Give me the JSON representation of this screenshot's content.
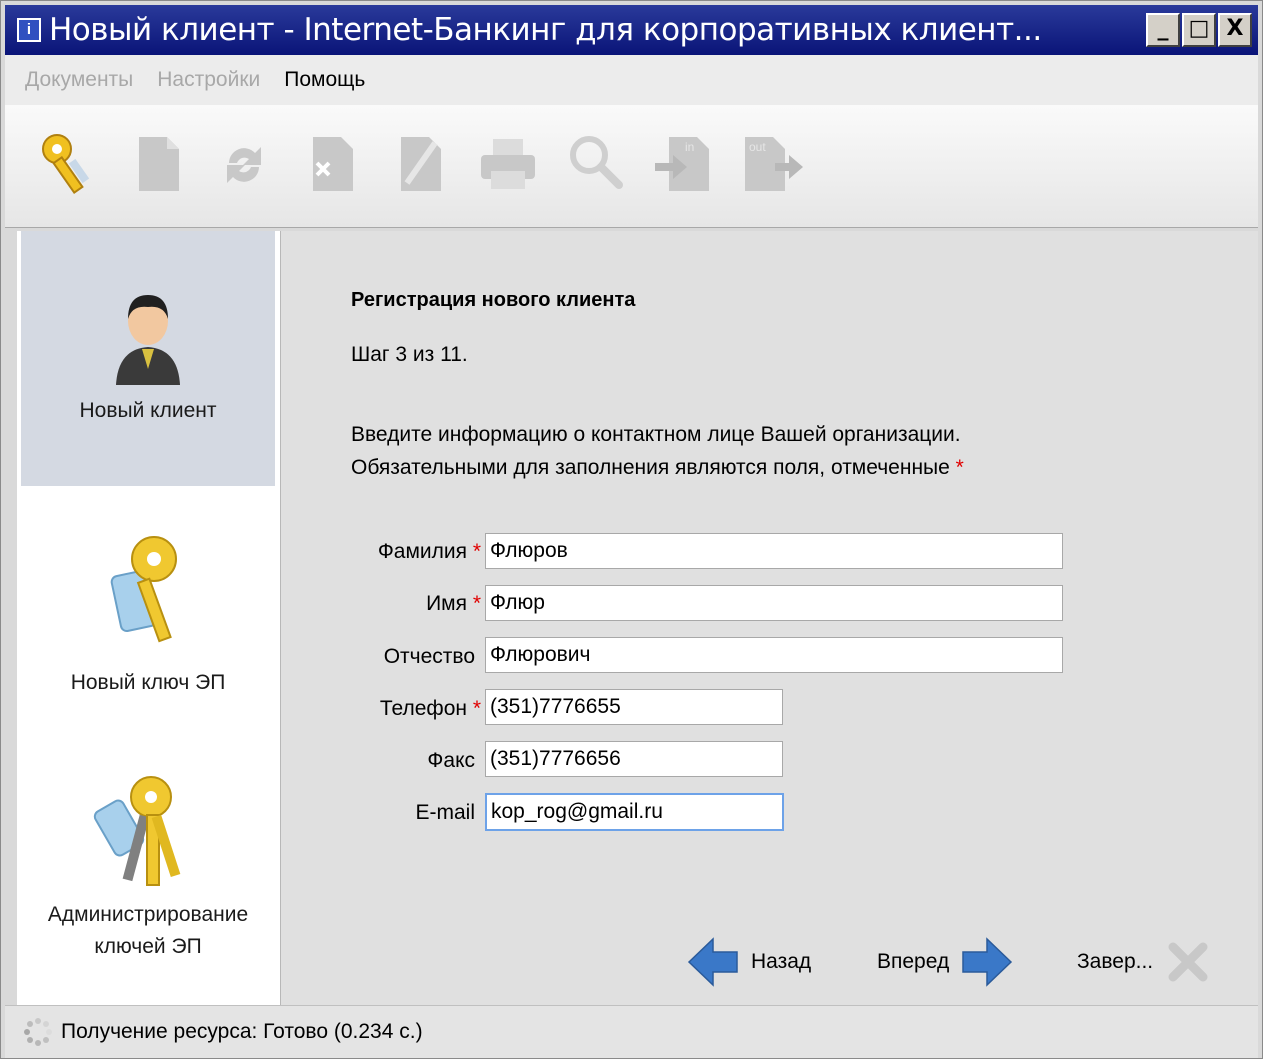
{
  "window": {
    "title": "Новый клиент - Internet-Банкинг для корпоративных клиент...",
    "minimize_label": "_",
    "maximize_label": "□",
    "close_label": "X"
  },
  "menu": {
    "items": [
      {
        "label": "Документы",
        "enabled": false
      },
      {
        "label": "Настройки",
        "enabled": false
      },
      {
        "label": "Помощь",
        "enabled": true
      }
    ]
  },
  "toolbar": {
    "icons": [
      "keys-icon",
      "new-document-icon",
      "refresh-icon",
      "delete-document-icon",
      "edit-document-icon",
      "print-icon",
      "search-icon",
      "import-in-icon",
      "export-out-icon"
    ],
    "in_label": "in",
    "out_label": "out"
  },
  "sidebar": {
    "items": [
      {
        "label": "Новый клиент",
        "selected": true,
        "icon": "user-icon"
      },
      {
        "label": "Новый ключ ЭП",
        "selected": false,
        "icon": "key-icon"
      },
      {
        "label_line1": "Администрирование",
        "label_line2": "ключей ЭП",
        "selected": false,
        "icon": "keys-bundle-icon"
      }
    ]
  },
  "form": {
    "title": "Регистрация нового клиента",
    "step": "Шаг 3 из 11.",
    "intro_line1": "Введите информацию о контактном лице Вашей организации.",
    "intro_line2": "Обязательными для заполнения являются поля, отмеченные",
    "required_mark": "*",
    "fields": {
      "surname": {
        "label": "Фамилия",
        "value": "Флюров",
        "required": true
      },
      "name": {
        "label": "Имя",
        "value": "Флюр",
        "required": true
      },
      "patronymic": {
        "label": "Отчество",
        "value": "Флюрович",
        "required": false
      },
      "phone": {
        "label": "Телефон",
        "value": "(351)7776655",
        "required": true
      },
      "fax": {
        "label": "Факс",
        "value": "(351)7776656",
        "required": false
      },
      "email": {
        "label": "E-mail",
        "value": "kop_rog@gmail.ru",
        "required": false
      }
    }
  },
  "nav": {
    "back_label": "Назад",
    "next_label": "Вперед",
    "finish_label": "Завер..."
  },
  "status": {
    "text": "Получение ресурса: Готово (0.234 с.)"
  },
  "colors": {
    "title_bar": "#0a1478",
    "selected_item": "#d4d9e2",
    "arrow_blue": "#3a78c8",
    "required_red": "#e00000",
    "focus_border": "#6da2e8"
  }
}
